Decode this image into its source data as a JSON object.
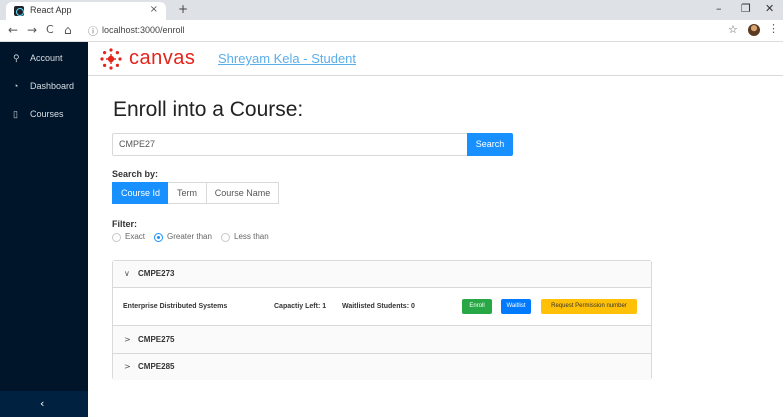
{
  "browser": {
    "tab_title": "React App",
    "tab_close": "×",
    "new_tab": "+",
    "url_info": "ⓘ",
    "url": "localhost:3000/enroll",
    "back": "←",
    "forward": "→",
    "reload": "C",
    "home": "⌂",
    "star": "☆",
    "menu": "⋮",
    "minimize": "–",
    "maximize": "❐",
    "close": "✕"
  },
  "sidebar": {
    "items": [
      {
        "icon": "user-icon",
        "glyph": "⚲",
        "label": "Account"
      },
      {
        "icon": "dashboard-icon",
        "glyph": "◔",
        "label": "Dashboard"
      },
      {
        "icon": "book-icon",
        "glyph": "▯",
        "label": "Courses"
      }
    ],
    "collapse_glyph": "‹"
  },
  "header": {
    "logo_text": "canvas",
    "user_link": "Shreyam Kela - Student",
    "brand_color": "#e4231b"
  },
  "main": {
    "title": "Enroll into a Course:",
    "search": {
      "value": "CMPE27",
      "button_label": "Search"
    },
    "search_by": {
      "label": "Search by:",
      "options": [
        "Course Id",
        "Term",
        "Course Name"
      ],
      "selected": "Course Id"
    },
    "filter": {
      "label": "Filter:",
      "options": [
        "Exact",
        "Greater than",
        "Less than"
      ],
      "selected": "Greater than"
    },
    "results": [
      {
        "code": "CMPE273",
        "expanded": true,
        "arrow": "∨",
        "name": "Enterprise Distributed Systems",
        "capacity": "Capactiy Left: 1",
        "waitlisted": "Waitlisted Students: 0",
        "buttons": {
          "enroll": "Enroll",
          "waitlist": "Waitlist",
          "permission": "Request Permission number"
        }
      },
      {
        "code": "CMPE275",
        "expanded": false,
        "arrow": ">"
      },
      {
        "code": "CMPE285",
        "expanded": false,
        "arrow": ">"
      }
    ]
  },
  "colors": {
    "sidebar_bg": "#001529",
    "primary": "#1890ff",
    "enroll": "#28a745",
    "waitlist": "#007bff",
    "permission": "#ffc107"
  }
}
